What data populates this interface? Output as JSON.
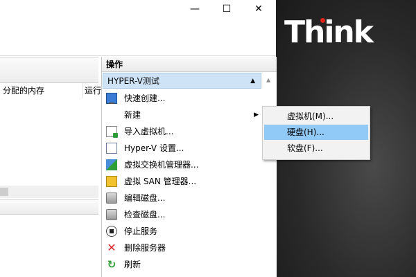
{
  "window": {
    "controls": {
      "minimize": "—",
      "maximize": "☐",
      "close": "✕"
    }
  },
  "left_pane": {
    "columns": [
      "分配的内存",
      "运行"
    ]
  },
  "actions_pane": {
    "title": "操作",
    "group_header": "HYPER-V测试",
    "items": [
      {
        "label": "快速创建...",
        "icon": "quick-create-icon"
      },
      {
        "label": "新建",
        "icon": "",
        "has_submenu": true
      },
      {
        "label": "导入虚拟机...",
        "icon": "import-vm-icon"
      },
      {
        "label": "Hyper-V 设置...",
        "icon": "settings-icon"
      },
      {
        "label": "虚拟交换机管理器...",
        "icon": "virtual-switch-icon"
      },
      {
        "label": "虚拟 SAN 管理器...",
        "icon": "virtual-san-icon"
      },
      {
        "label": "编辑磁盘...",
        "icon": "edit-disk-icon"
      },
      {
        "label": "检查磁盘...",
        "icon": "inspect-disk-icon"
      },
      {
        "label": "停止服务",
        "icon": "stop-icon"
      },
      {
        "label": "删除服务器",
        "icon": "delete-icon"
      },
      {
        "label": "刷新",
        "icon": "refresh-icon"
      }
    ]
  },
  "submenu": {
    "items": [
      {
        "label": "虚拟机(M)...",
        "selected": false
      },
      {
        "label": "硬盘(H)...",
        "selected": true
      },
      {
        "label": "软盘(F)...",
        "selected": false
      }
    ]
  },
  "desktop": {
    "logo_text": "Think",
    "logo_dot_color": "#e2231a"
  },
  "colors": {
    "group_header_bg": "#cfe3f6",
    "submenu_selected": "#91c9f7"
  }
}
